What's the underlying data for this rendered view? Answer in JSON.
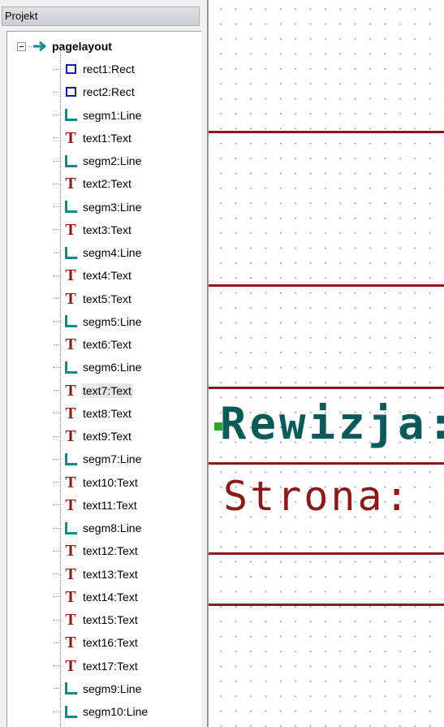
{
  "panel": {
    "title": "Projekt"
  },
  "tree": {
    "root_label": "pagelayout",
    "items": [
      {
        "label": "rect1:Rect",
        "icon": "rect-icon"
      },
      {
        "label": "rect2:Rect",
        "icon": "rect-icon"
      },
      {
        "label": "segm1:Line",
        "icon": "line-icon"
      },
      {
        "label": "text1:Text",
        "icon": "text-icon"
      },
      {
        "label": "segm2:Line",
        "icon": "line-icon"
      },
      {
        "label": "text2:Text",
        "icon": "text-icon"
      },
      {
        "label": "segm3:Line",
        "icon": "line-icon"
      },
      {
        "label": "text3:Text",
        "icon": "text-icon"
      },
      {
        "label": "segm4:Line",
        "icon": "line-icon"
      },
      {
        "label": "text4:Text",
        "icon": "text-icon"
      },
      {
        "label": "text5:Text",
        "icon": "text-icon"
      },
      {
        "label": "segm5:Line",
        "icon": "line-icon"
      },
      {
        "label": "text6:Text",
        "icon": "text-icon"
      },
      {
        "label": "segm6:Line",
        "icon": "line-icon"
      },
      {
        "label": "text7:Text",
        "icon": "text-icon",
        "selected": true
      },
      {
        "label": "text8:Text",
        "icon": "text-icon"
      },
      {
        "label": "text9:Text",
        "icon": "text-icon"
      },
      {
        "label": "segm7:Line",
        "icon": "line-icon"
      },
      {
        "label": "text10:Text",
        "icon": "text-icon"
      },
      {
        "label": "text11:Text",
        "icon": "text-icon"
      },
      {
        "label": "segm8:Line",
        "icon": "line-icon"
      },
      {
        "label": "text12:Text",
        "icon": "text-icon"
      },
      {
        "label": "text13:Text",
        "icon": "text-icon"
      },
      {
        "label": "text14:Text",
        "icon": "text-icon"
      },
      {
        "label": "text15:Text",
        "icon": "text-icon"
      },
      {
        "label": "text16:Text",
        "icon": "text-icon"
      },
      {
        "label": "text17:Text",
        "icon": "text-icon"
      },
      {
        "label": "segm9:Line",
        "icon": "line-icon"
      },
      {
        "label": "segm10:Line",
        "icon": "line-icon"
      }
    ]
  },
  "canvas": {
    "text_rewizja": "Rewizja:",
    "text_strona": "Strona:"
  },
  "colors": {
    "line_color": "#8b1a1a",
    "rewizja_color": "#0b5a5a",
    "strona_color": "#8b1a1a",
    "rect_icon": "#1a1aa8",
    "line_icon": "#0e8a8a",
    "text_icon": "#8b1a1a",
    "anchor": "#2aa82a"
  }
}
